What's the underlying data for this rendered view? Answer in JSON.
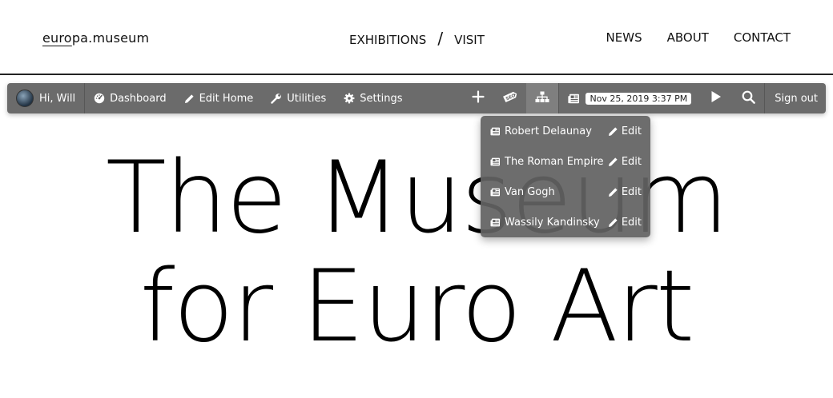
{
  "site": {
    "logo_prefix": "euro",
    "logo_suffix": "pa.museum",
    "nav_center": [
      "EXHIBITIONS",
      "/",
      "VISIT"
    ],
    "nav_right": [
      "NEWS",
      "ABOUT",
      "CONTACT"
    ]
  },
  "hero": {
    "line1": "The Museum",
    "line2": "for Euro Art"
  },
  "toolbar": {
    "greeting": "Hi, Will",
    "dashboard": "Dashboard",
    "edit_home": "Edit Home",
    "utilities": "Utilities",
    "settings": "Settings",
    "date": "Nov 25, 2019 3:37 PM",
    "signout": "Sign out",
    "icons": [
      "plus-icon",
      "seo-tag-icon",
      "sitemap-icon",
      "newspaper-icon",
      "play-icon",
      "search-icon"
    ]
  },
  "dropdown": {
    "items": [
      {
        "title": "Robert Delaunay",
        "action": "Edit"
      },
      {
        "title": "The Roman Empire",
        "action": "Edit"
      },
      {
        "title": "Van Gogh",
        "action": "Edit"
      },
      {
        "title": "Wassily Kandinsky",
        "action": "Edit"
      }
    ]
  },
  "colors": {
    "toolbar_bg": "#626262",
    "text_light": "#ffffff",
    "page_bg": "#ffffff",
    "hero_text": "#000000"
  }
}
